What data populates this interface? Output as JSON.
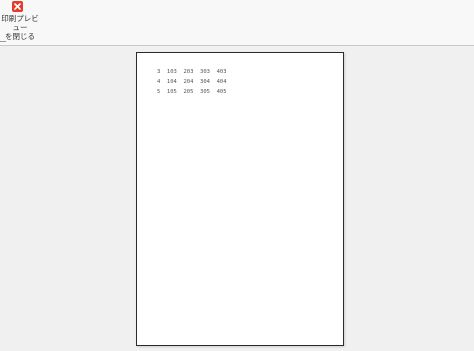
{
  "toolbar": {
    "close_preview_label": "印刷プレビュー\nを閉じる"
  },
  "icons": {
    "close": "close-icon"
  },
  "colors": {
    "close_icon": "#e23c2c"
  },
  "page": {
    "lines": [
      "3  103  203  303  403",
      "4  104  204  304  404",
      "5  105  205  305  405"
    ]
  }
}
